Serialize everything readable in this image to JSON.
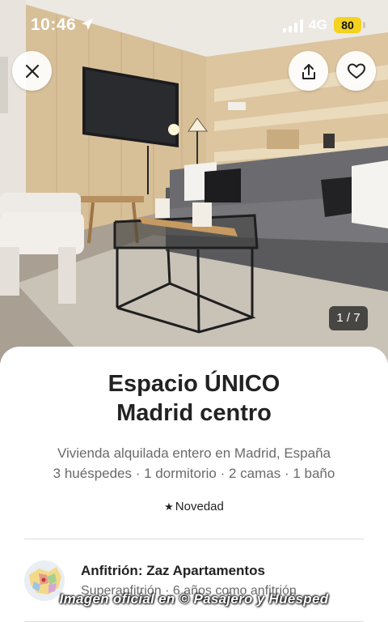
{
  "status_bar": {
    "time": "10:46",
    "network": "4G",
    "battery": "80"
  },
  "photo": {
    "counter": "1 / 7"
  },
  "actions": {
    "close_icon": "close-icon",
    "share_icon": "share-icon",
    "save_icon": "heart-icon"
  },
  "listing": {
    "title_line1": "Espacio ÚNICO",
    "title_line2": "Madrid centro",
    "subtitle": "Vivienda alquilada entero en Madrid, España",
    "details": "3 huéspedes · 1 dormitorio · 2 camas · 1 baño",
    "badge": "Novedad"
  },
  "host": {
    "title": "Anfitrión: Zaz Apartamentos",
    "meta": "Superanfitrión · 6 años como anfitrión"
  },
  "watermark": "Imagen oficial en © Pasajero y Huésped",
  "colors": {
    "battery": "#f5d21e",
    "text_primary": "#222222",
    "text_secondary": "#6a6a6a"
  }
}
